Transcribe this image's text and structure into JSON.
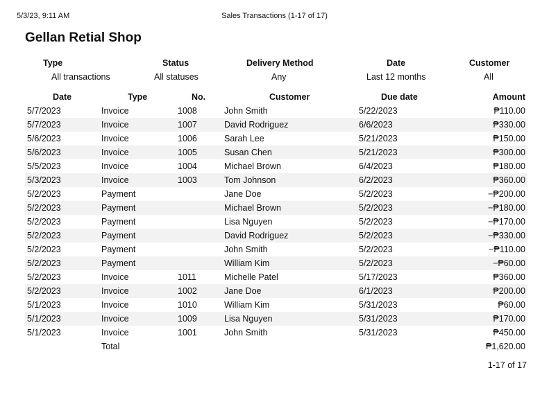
{
  "header": {
    "timestamp": "5/3/23, 9:11 AM",
    "page_title": "Sales Transactions (1-17 of 17)"
  },
  "shop_name": "Gellan Retial Shop",
  "filters": [
    {
      "label": "Type",
      "value": "All transactions"
    },
    {
      "label": "Status",
      "value": "All statuses"
    },
    {
      "label": "Delivery Method",
      "value": "Any"
    },
    {
      "label": "Date",
      "value": "Last 12 months"
    },
    {
      "label": "Customer",
      "value": "All"
    }
  ],
  "table": {
    "columns": {
      "date": "Date",
      "type": "Type",
      "no": "No.",
      "customer": "Customer",
      "due": "Due date",
      "amount": "Amount"
    },
    "rows": [
      {
        "date": "5/7/2023",
        "type": "Invoice",
        "no": "1008",
        "customer": "John Smith",
        "due": "5/22/2023",
        "amount": "₱110.00"
      },
      {
        "date": "5/7/2023",
        "type": "Invoice",
        "no": "1007",
        "customer": "David Rodriguez",
        "due": "6/6/2023",
        "amount": "₱330.00"
      },
      {
        "date": "5/6/2023",
        "type": "Invoice",
        "no": "1006",
        "customer": "Sarah Lee",
        "due": "5/21/2023",
        "amount": "₱150.00"
      },
      {
        "date": "5/6/2023",
        "type": "Invoice",
        "no": "1005",
        "customer": "Susan Chen",
        "due": "5/21/2023",
        "amount": "₱300.00"
      },
      {
        "date": "5/5/2023",
        "type": "Invoice",
        "no": "1004",
        "customer": "Michael Brown",
        "due": "6/4/2023",
        "amount": "₱180.00"
      },
      {
        "date": "5/3/2023",
        "type": "Invoice",
        "no": "1003",
        "customer": "Tom Johnson",
        "due": "6/2/2023",
        "amount": "₱360.00"
      },
      {
        "date": "5/2/2023",
        "type": "Payment",
        "no": "",
        "customer": "Jane Doe",
        "due": "5/2/2023",
        "amount": "−₱200.00"
      },
      {
        "date": "5/2/2023",
        "type": "Payment",
        "no": "",
        "customer": "Michael Brown",
        "due": "5/2/2023",
        "amount": "−₱180.00"
      },
      {
        "date": "5/2/2023",
        "type": "Payment",
        "no": "",
        "customer": "Lisa Nguyen",
        "due": "5/2/2023",
        "amount": "−₱170.00"
      },
      {
        "date": "5/2/2023",
        "type": "Payment",
        "no": "",
        "customer": "David Rodriguez",
        "due": "5/2/2023",
        "amount": "−₱330.00"
      },
      {
        "date": "5/2/2023",
        "type": "Payment",
        "no": "",
        "customer": "John Smith",
        "due": "5/2/2023",
        "amount": "−₱110.00"
      },
      {
        "date": "5/2/2023",
        "type": "Payment",
        "no": "",
        "customer": "William Kim",
        "due": "5/2/2023",
        "amount": "−₱60.00"
      },
      {
        "date": "5/2/2023",
        "type": "Invoice",
        "no": "1011",
        "customer": "Michelle Patel",
        "due": "5/17/2023",
        "amount": "₱360.00"
      },
      {
        "date": "5/2/2023",
        "type": "Invoice",
        "no": "1002",
        "customer": "Jane Doe",
        "due": "6/1/2023",
        "amount": "₱200.00"
      },
      {
        "date": "5/1/2023",
        "type": "Invoice",
        "no": "1010",
        "customer": "William Kim",
        "due": "5/31/2023",
        "amount": "₱60.00"
      },
      {
        "date": "5/1/2023",
        "type": "Invoice",
        "no": "1009",
        "customer": "Lisa Nguyen",
        "due": "5/31/2023",
        "amount": "₱170.00"
      },
      {
        "date": "5/1/2023",
        "type": "Invoice",
        "no": "1001",
        "customer": "John Smith",
        "due": "5/31/2023",
        "amount": "₱450.00"
      }
    ],
    "total": {
      "label": "Total",
      "amount": "₱1,620.00"
    }
  },
  "pager": "1-17 of 17"
}
